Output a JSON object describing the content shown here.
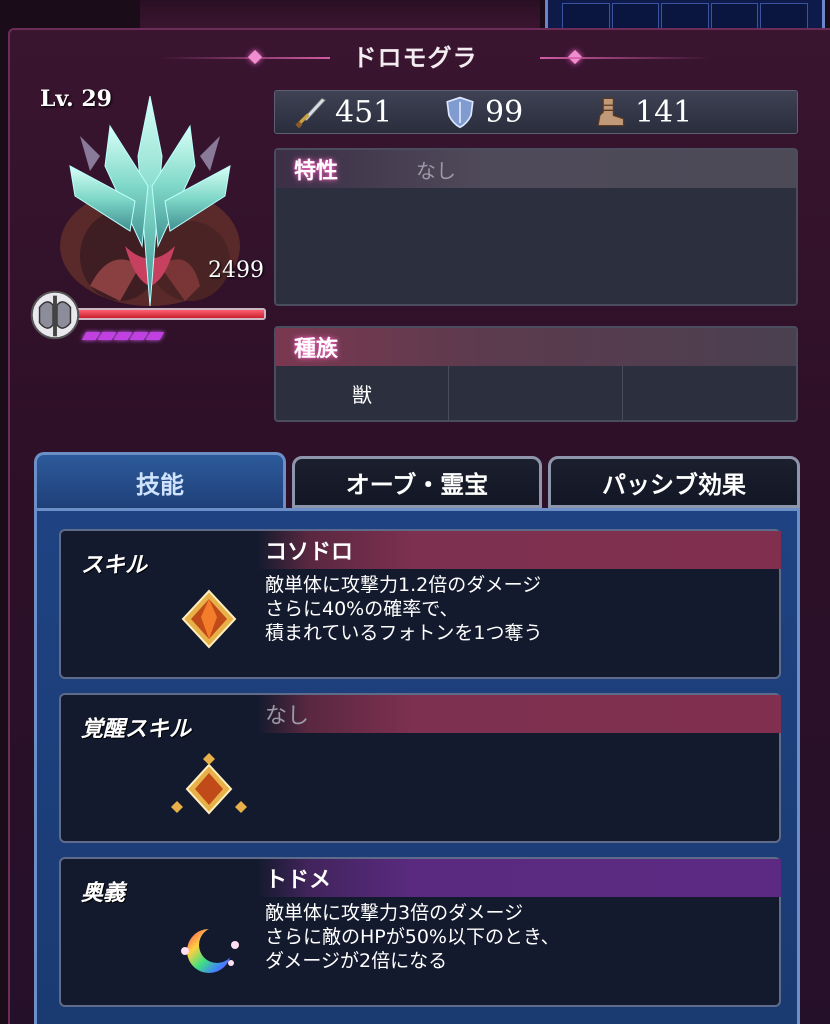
{
  "title": "ドロモグラ",
  "unit": {
    "level": "Lv. 29",
    "hp": "2499",
    "hp_fraction": 1.0,
    "break_segments": 5
  },
  "stats": {
    "attack": "451",
    "defense": "99",
    "speed": "141"
  },
  "trait": {
    "label": "特性",
    "value": "なし"
  },
  "race": {
    "label": "種族",
    "cells": [
      "獣",
      "",
      ""
    ]
  },
  "tabs": [
    {
      "label": "技能",
      "active": true
    },
    {
      "label": "オーブ・霊宝",
      "active": false
    },
    {
      "label": "パッシブ効果",
      "active": false
    }
  ],
  "skills": [
    {
      "type": "スキル",
      "name": "コソドロ",
      "description": "敵単体に攻撃力1.2倍のダメージ\nさらに40%の確率で、\n積まれているフォトンを1つ奪う",
      "icon": "photon-crystal-icon",
      "color": "#80304e"
    },
    {
      "type": "覚醒スキル",
      "name": "なし",
      "description": "",
      "icon": "awaken-crystal-icon",
      "color": "#80304e"
    },
    {
      "type": "奥義",
      "name": "トドメ",
      "description": "敵単体に攻撃力3倍のダメージ\nさらに敵のHPが50%以下のとき、\nダメージが2倍になる",
      "icon": "rainbow-moon-icon",
      "color": "#5c2a82"
    }
  ],
  "colors": {
    "frame": "#3a1530",
    "accent_pink": "#d05ca4",
    "skills_bg": "#1f4382",
    "hp_bar": "#e03040"
  }
}
